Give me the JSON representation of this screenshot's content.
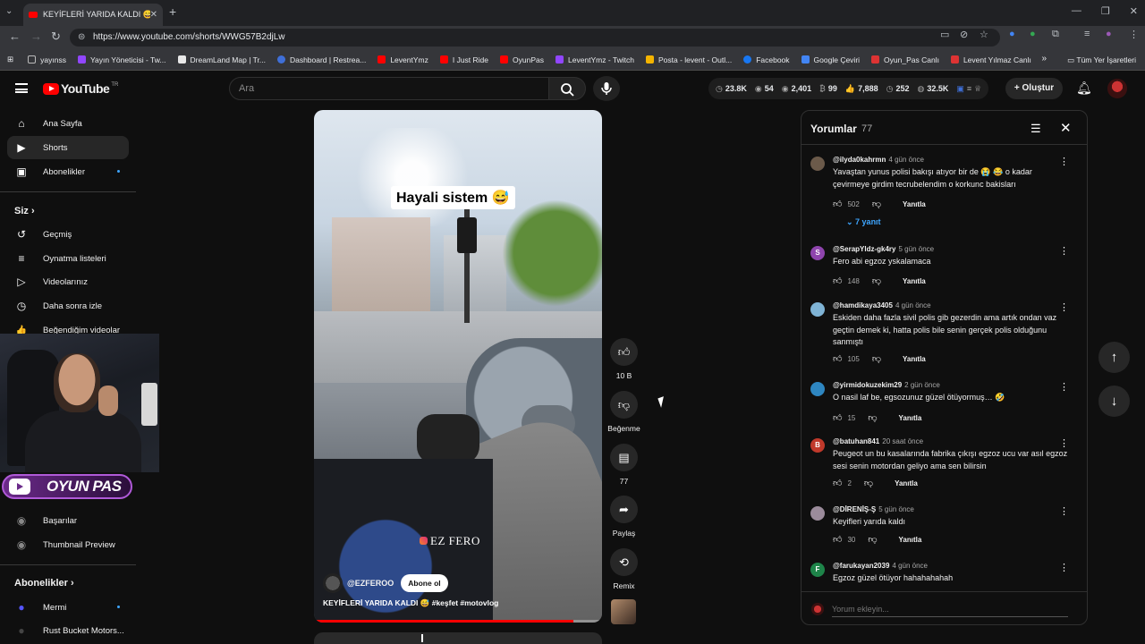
{
  "browser": {
    "tab_title": "KEYİFLERİ YARIDA KALDI 😅",
    "url": "https://www.youtube.com/shorts/WWG57B2djLw",
    "bookmarks": [
      {
        "label": "yayınss",
        "color": "#8a8a8a"
      },
      {
        "label": "Yayın Yöneticisi - Tw...",
        "color": "#9146ff"
      },
      {
        "label": "DreamLand Map | Tr...",
        "color": "#e8e8e8"
      },
      {
        "label": "Dashboard | Restrea...",
        "color": "#3f6fd8"
      },
      {
        "label": "LeventYmz",
        "color": "#ff0000"
      },
      {
        "label": "I Just Ride",
        "color": "#ff0000"
      },
      {
        "label": "OyunPas",
        "color": "#ff0000"
      },
      {
        "label": "LeventYmz - Twitch",
        "color": "#9146ff"
      },
      {
        "label": "Posta - levent - Outl...",
        "color": "#f4b400"
      },
      {
        "label": "Facebook",
        "color": "#1877f2"
      },
      {
        "label": "Google Çeviri",
        "color": "#4285f4"
      },
      {
        "label": "Oyun_Pas Canlı",
        "color": "#d33"
      },
      {
        "label": "Levent Yılmaz Canlı",
        "color": "#d33"
      }
    ],
    "all_bookmarks": "Tüm Yer İşaretleri"
  },
  "header": {
    "logo_text": "YouTube",
    "logo_country": "TR",
    "search_placeholder": "Ara",
    "stats": [
      "23.8K",
      "54",
      "2,401",
      "99",
      "7,888",
      "252",
      "32.5K"
    ],
    "create_label": "Oluştur"
  },
  "sidebar": {
    "top_items": [
      {
        "label": "Ana Sayfa",
        "icon": "⌂"
      },
      {
        "label": "Shorts",
        "icon": "▶"
      },
      {
        "label": "Abonelikler",
        "icon": "▣"
      }
    ],
    "you_heading": "Siz",
    "you_items": [
      {
        "label": "Geçmiş",
        "icon": "↺"
      },
      {
        "label": "Oynatma listeleri",
        "icon": "≡"
      },
      {
        "label": "Videolarınız",
        "icon": "▷"
      },
      {
        "label": "Daha sonra izle",
        "icon": "◷"
      },
      {
        "label": "Beğendiğim videolar",
        "icon": "👍"
      }
    ],
    "tool_items": [
      {
        "label": "Başarılar"
      },
      {
        "label": "Thumbnail Preview"
      }
    ],
    "subs_heading": "Abonelikler",
    "subs": [
      {
        "label": "Mermi"
      },
      {
        "label": "Rust Bucket Motors..."
      }
    ],
    "channel_banner": "OYUN PAS"
  },
  "short": {
    "caption": "Hayali sistem 😅",
    "watermark": "EZ FERO",
    "channel": "@EZFEROO",
    "subscribe_label": "Abone ol",
    "title": "KEYİFLERİ YARIDA KALDI 😅 #keşfet #motovlog",
    "progress": 0.9
  },
  "actions": {
    "likes": "10 B",
    "dislike_label": "Beğenme",
    "comments": "77",
    "share_label": "Paylaş",
    "remix_label": "Remix"
  },
  "comments": {
    "title": "Yorumlar",
    "count": "77",
    "reply_label": "Yanıtla",
    "replies_toggle": "7 yanıt",
    "input_placeholder": "Yorum ekleyin...",
    "items": [
      {
        "author": "@ilyda0kahrmn",
        "time": "4 gün önce",
        "text": "Yavaştan yunus polisi bakışı atıyor bir de 😭 😂 o kadar çevirmeye girdim tecrubelendim o korkunc bakisları",
        "likes": "502",
        "avatar_letter": "",
        "avatar_color": "#6b5a4a"
      },
      {
        "author": "@SerapYldz-gk4ry",
        "time": "5 gün önce",
        "text": "Fero abi egzoz yskalamaca",
        "likes": "148",
        "avatar_letter": "S",
        "avatar_color": "#8e44ad"
      },
      {
        "author": "@hamdikaya3405",
        "time": "4 gün önce",
        "text": "Eskiden daha fazla sivil polis gib gezerdin ama artık ondan vaz geçtin demek ki, hatta polis bile senin gerçek polis olduğunu sanmıştı",
        "likes": "105",
        "avatar_letter": "",
        "avatar_color": "#7fb3d5"
      },
      {
        "author": "@yirmidokuzekim29",
        "time": "2 gün önce",
        "text": "O nasil laf be, egsozunuz güzel ötüyormuş… 🤣",
        "likes": "15",
        "avatar_letter": "",
        "avatar_color": "#2e86c1"
      },
      {
        "author": "@batuhan841",
        "time": "20 saat önce",
        "text": "Peugeot un bu kasalarında fabrika çıkışı egzoz ucu var asıl egzoz sesi senin motordan geliyo ama sen bilirsin",
        "likes": "2",
        "avatar_letter": "B",
        "avatar_color": "#c0392b"
      },
      {
        "author": "@DİRENİŞ-Ş",
        "time": "5 gün önce",
        "text": "Keyifleri yarıda kaldı",
        "likes": "30",
        "avatar_letter": "",
        "avatar_color": "#9b8b9b"
      },
      {
        "author": "@farukayan2039",
        "time": "4 gün önce",
        "text": "Egzoz güzel ötüyor hahahahahah",
        "likes": "",
        "avatar_letter": "F",
        "avatar_color": "#1e8449"
      }
    ]
  }
}
